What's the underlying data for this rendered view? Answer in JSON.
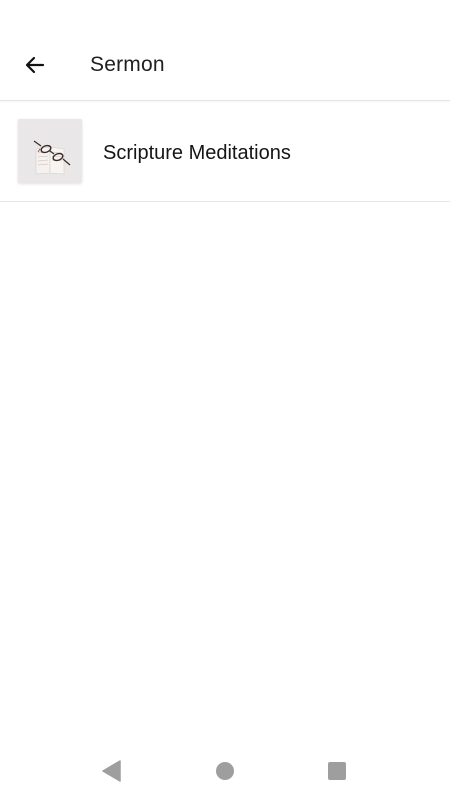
{
  "header": {
    "title": "Sermon",
    "back_icon": "arrow-left-icon"
  },
  "list": {
    "items": [
      {
        "label": "Scripture Meditations",
        "thumbnail_icon": "book-with-glasses-thumbnail"
      }
    ]
  },
  "system_nav": {
    "back_icon": "triangle-back-icon",
    "home_icon": "circle-home-icon",
    "recents_icon": "square-recents-icon",
    "icon_color": "#9e9e9e"
  }
}
